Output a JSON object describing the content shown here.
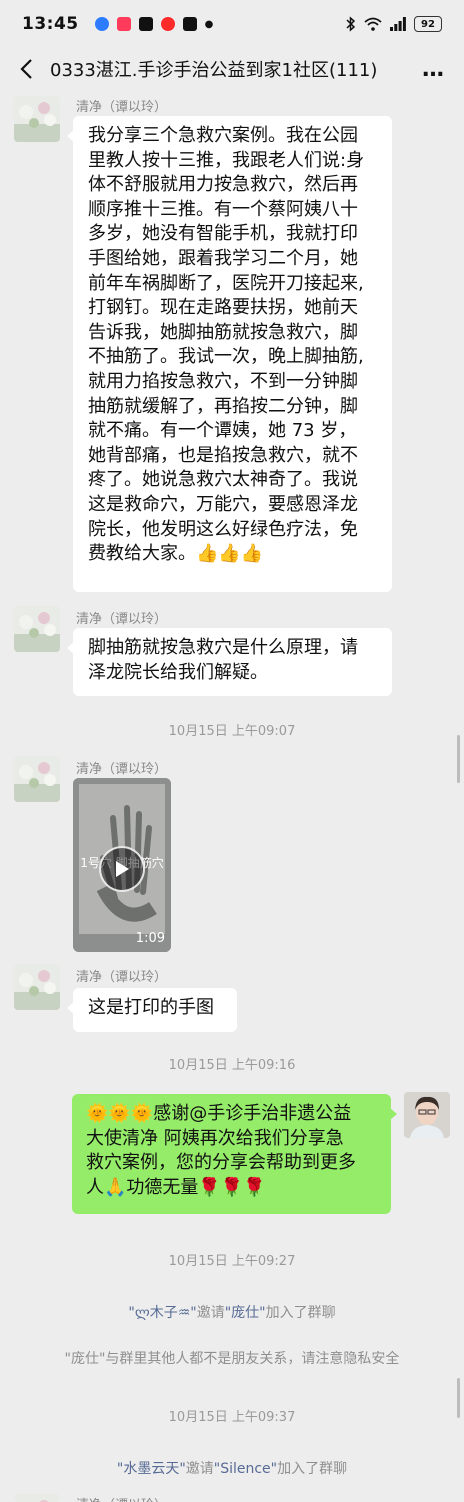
{
  "status_bar": {
    "time": "13:45",
    "battery": "92",
    "icons": [
      "bluetooth-icon",
      "wifi-icon",
      "signal-icon"
    ]
  },
  "header": {
    "title": "0333湛江.手诊手治公益到家1社区(111)",
    "more": "…"
  },
  "messages": [
    {
      "sender": "清净（谭以玲）",
      "lines": [
        "我分享三个急救穴案例。我在公园",
        "里教人按十三推，我跟老人们说:身",
        "体不舒服就用力按急救穴，然后再",
        "顺序推十三推。有一个蔡阿姨八十",
        "多岁，她没有智能手机，我就打印",
        "手图给她，跟着我学习二个月，她",
        "前年车祸脚断了，医院开刀接起来,",
        "打钢钉。现在走路要扶拐，她前天",
        "告诉我，她脚抽筋就按急救穴，脚",
        "不抽筋了。我试一次，晚上脚抽筋,",
        "就用力掐按急救穴，不到一分钟脚",
        "抽筋就缓解了，再掐按二分钟，脚",
        "就不痛。有一个谭姨，她 73 岁，",
        "她背部痛，也是掐按急救穴，就不",
        "疼了。她说急救穴太神奇了。我说",
        "这是救命穴，万能穴，要感恩泽龙",
        "院长，他发明这么好绿色疗法，免",
        "费教给大家。👍👍👍"
      ]
    },
    {
      "sender": "清净（谭以玲）",
      "lines": [
        "脚抽筋就按急救穴是什么原理，请",
        "泽龙院长给我们解疑。"
      ]
    },
    {
      "sender": "清净（谭以玲）",
      "video_duration": "1:09",
      "video_caption": "1号穴 脚抽筋穴"
    },
    {
      "sender": "清净（谭以玲）",
      "lines": [
        "这是打印的手图"
      ]
    },
    {
      "lines": [
        "🌞🌞🌞感谢@手诊手治非遗公益",
        "大使清净  阿姨再次给我们分享急",
        "救穴案例，您的分享会帮助到更多",
        "人🙏功德无量🌹🌹🌹"
      ]
    },
    {
      "sender": "清净（谭以玲）"
    }
  ],
  "timestamps": [
    "10月15日 上午09:07",
    "10月15日 上午09:16",
    "10月15日 上午09:27",
    "10月15日 上午09:37"
  ],
  "system": [
    {
      "actor": "\"ლ木子♒\"",
      "verb": "邀请",
      "target": "\"庞仕\"",
      "tail": "加入了群聊"
    },
    {
      "text": "\"庞仕\"与群里其他人都不是朋友关系，请注意隐私安全"
    },
    {
      "actor": "\"水墨云天\"",
      "verb": "邀请",
      "target": "\"Silence\"",
      "tail": "加入了群聊"
    }
  ],
  "colors": {
    "background": "#ededed",
    "bubble_in": "#ffffff",
    "bubble_out": "#95ec69",
    "link_name": "#576b95"
  }
}
